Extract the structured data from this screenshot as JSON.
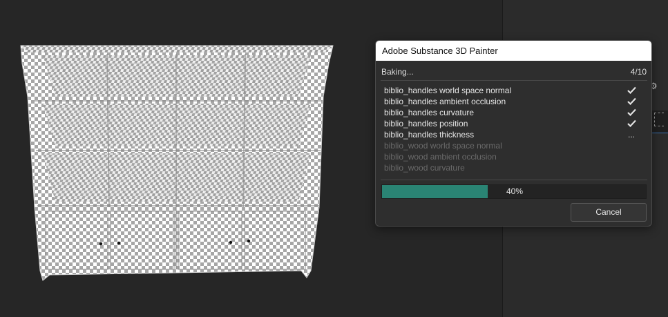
{
  "dialog": {
    "title": "Adobe Substance 3D Painter",
    "status_label": "Baking...",
    "progress_count": "4/10",
    "items": [
      {
        "name": "biblio_handles world space normal",
        "status": "done",
        "status_icon": "check-icon"
      },
      {
        "name": "biblio_handles ambient occlusion",
        "status": "done",
        "status_icon": "check-icon"
      },
      {
        "name": "biblio_handles curvature",
        "status": "done",
        "status_icon": "check-icon"
      },
      {
        "name": "biblio_handles position",
        "status": "done",
        "status_icon": "check-icon"
      },
      {
        "name": "biblio_handles thickness",
        "status": "in_progress",
        "status_text": "..."
      },
      {
        "name": "biblio_wood world space normal",
        "status": "pending"
      },
      {
        "name": "biblio_wood ambient occlusion",
        "status": "pending"
      },
      {
        "name": "biblio_wood curvature",
        "status": "pending"
      }
    ],
    "progress_fraction": 0.4,
    "progress_text": "40%",
    "cancel_label": "Cancel"
  },
  "colors": {
    "progress_fill": "#2a8474",
    "viewport_bg": "#262626",
    "dialog_bg": "#2e2e2e",
    "title_bar_bg": "#ffffff",
    "selection_accent": "#3a73b5"
  },
  "viewport": {
    "model": "bookshelf-mesh",
    "texture": "checker-placeholder"
  }
}
